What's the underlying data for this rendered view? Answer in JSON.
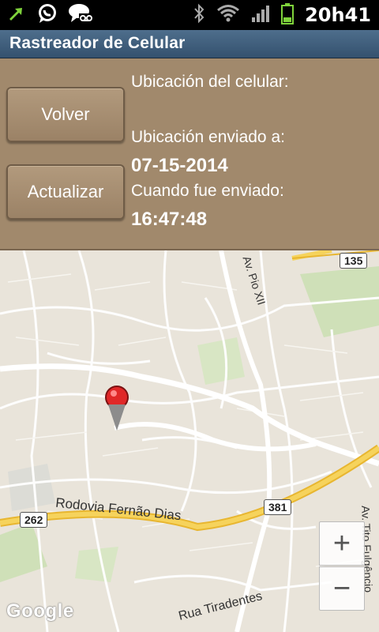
{
  "status_bar": {
    "time": "20h41",
    "left_icons": [
      "sync-icon",
      "whatsapp-icon",
      "voicemail-icon"
    ],
    "right_icons": [
      "bluetooth-icon",
      "wifi-icon",
      "signal-icon",
      "battery-icon"
    ]
  },
  "app": {
    "title": "Rastreador de Celular"
  },
  "buttons": {
    "back": "Volver",
    "update": "Actualizar"
  },
  "info": {
    "location_label": "Ubicación del celular:",
    "sent_to_label": "Ubicación enviado a:",
    "date": "07-15-2014",
    "when_label": "Cuando fue enviado:",
    "time": "16:47:48"
  },
  "map": {
    "road_1": "Rodovia Fernão Dias",
    "road_2": "Rua Tiradentes",
    "road_3": "Av. Pio XII",
    "road_4": "Av. Tito Fulgêncio",
    "shield_1": "135",
    "shield_2": "381",
    "shield_3": "262",
    "attribution": "Google",
    "zoom_in": "+",
    "zoom_out": "−",
    "colors": {
      "background": "#e9e4da",
      "highway": "#f2c94c",
      "road": "#ffffff",
      "park": "#cfe0b8",
      "pin": "#e02828"
    }
  }
}
